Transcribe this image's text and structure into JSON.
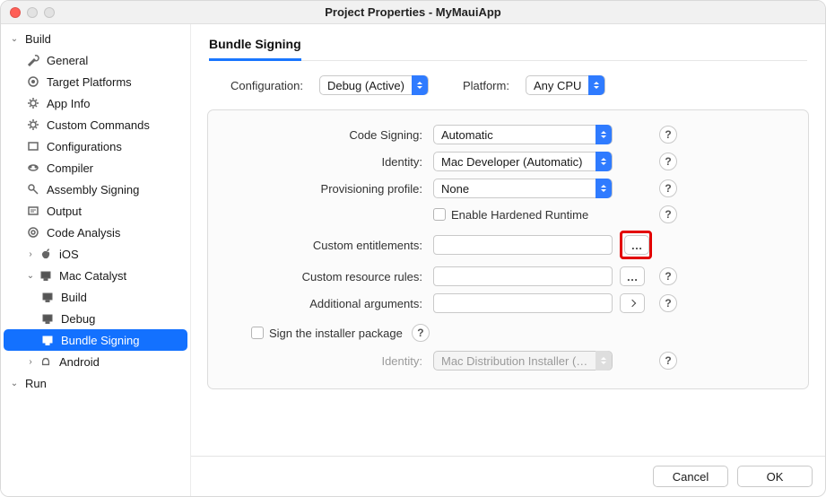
{
  "window": {
    "title": "Project Properties - MyMauiApp"
  },
  "sidebar": {
    "build": {
      "label": "Build",
      "items": {
        "general": "General",
        "target_platforms": "Target Platforms",
        "app_info": "App Info",
        "custom_commands": "Custom Commands",
        "configurations": "Configurations",
        "compiler": "Compiler",
        "assembly_signing": "Assembly Signing",
        "output": "Output",
        "code_analysis": "Code Analysis",
        "ios": "iOS",
        "mac_catalyst": {
          "label": "Mac Catalyst",
          "build": "Build",
          "debug": "Debug",
          "bundle_signing": "Bundle Signing"
        },
        "android": "Android"
      }
    },
    "run": {
      "label": "Run"
    }
  },
  "section": {
    "tab": "Bundle Signing"
  },
  "toprow": {
    "configuration_label": "Configuration:",
    "configuration_value": "Debug (Active)",
    "platform_label": "Platform:",
    "platform_value": "Any CPU"
  },
  "form": {
    "code_signing_label": "Code Signing:",
    "code_signing_value": "Automatic",
    "identity_label": "Identity:",
    "identity_value": "Mac Developer (Automatic)",
    "provisioning_label": "Provisioning profile:",
    "provisioning_value": "None",
    "hardened_label": "Enable Hardened Runtime",
    "custom_entitlements_label": "Custom entitlements:",
    "custom_entitlements_value": "",
    "custom_resource_rules_label": "Custom resource rules:",
    "custom_resource_rules_value": "",
    "additional_args_label": "Additional arguments:",
    "additional_args_value": "",
    "sign_installer_label": "Sign the installer package",
    "installer_identity_label": "Identity:",
    "installer_identity_value": "Mac Distribution Installer (…"
  },
  "footer": {
    "cancel": "Cancel",
    "ok": "OK"
  },
  "help": "?"
}
